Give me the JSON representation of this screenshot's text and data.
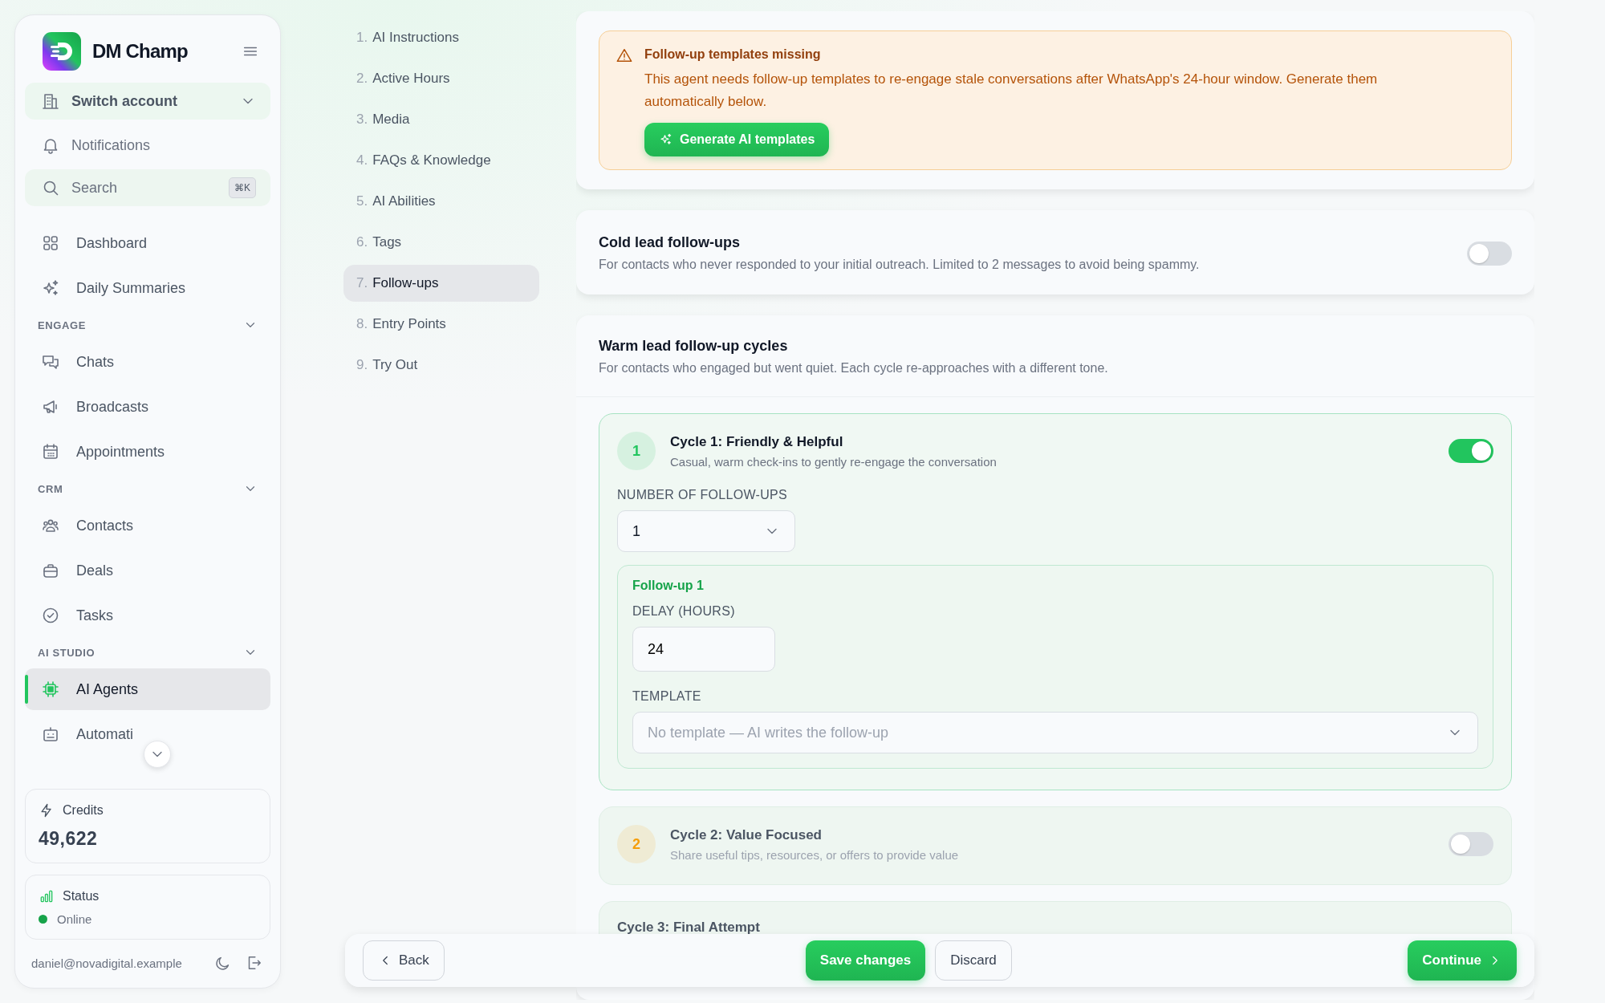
{
  "sidebar": {
    "brand": "DM Champ",
    "switch_account": "Switch account",
    "notifications": "Notifications",
    "search": {
      "placeholder": "Search",
      "shortcut": "⌘K"
    },
    "items": [
      {
        "label": "Dashboard",
        "selected": false
      },
      {
        "label": "Daily Summaries",
        "selected": false
      }
    ],
    "sections": [
      {
        "title": "ENGAGE",
        "items": [
          {
            "label": "Chats",
            "selected": false
          },
          {
            "label": "Broadcasts",
            "selected": false
          },
          {
            "label": "Appointments",
            "selected": false
          }
        ]
      },
      {
        "title": "CRM",
        "items": [
          {
            "label": "Contacts",
            "selected": false
          },
          {
            "label": "Deals",
            "selected": false
          },
          {
            "label": "Tasks",
            "selected": false
          }
        ]
      },
      {
        "title": "AI STUDIO",
        "items": [
          {
            "label": "AI Agents",
            "selected": true
          },
          {
            "label": "Automati",
            "selected": false
          }
        ]
      }
    ],
    "credits": {
      "label": "Credits",
      "value": "49,622"
    },
    "status": {
      "label": "Status",
      "value": "Online",
      "color": "#16a34a"
    },
    "user_email": "daniel@novadigital.example"
  },
  "steps": [
    {
      "number": "1.",
      "label": "AI Instructions",
      "selected": false
    },
    {
      "number": "2.",
      "label": "Active Hours",
      "selected": false
    },
    {
      "number": "3.",
      "label": "Media",
      "selected": false
    },
    {
      "number": "4.",
      "label": "FAQs & Knowledge",
      "selected": false
    },
    {
      "number": "5.",
      "label": "AI Abilities",
      "selected": false
    },
    {
      "number": "6.",
      "label": "Tags",
      "selected": false
    },
    {
      "number": "7.",
      "label": "Follow-ups",
      "selected": true
    },
    {
      "number": "8.",
      "label": "Entry Points",
      "selected": false
    },
    {
      "number": "9.",
      "label": "Try Out",
      "selected": false
    }
  ],
  "alert": {
    "title": "Follow-up templates missing",
    "message": "This agent needs follow-up templates to re-engage stale conversations after WhatsApp's 24-hour window. Generate them automatically below.",
    "button": "Generate AI templates"
  },
  "cold_leads": {
    "title": "Cold lead follow-ups",
    "description": "For contacts who never responded to your initial outreach. Limited to 2 messages to avoid being spammy.",
    "on": false
  },
  "warm_leads": {
    "title": "Warm lead follow-up cycles",
    "description": "For contacts who engaged but went quiet. Each cycle re-approaches with a different tone.",
    "cycles": [
      {
        "number": "1",
        "title": "Cycle 1: Friendly & Helpful",
        "description": "Casual, warm check-ins to gently re-engage the conversation",
        "on": true,
        "color": "#22c55e",
        "count_label": "NUMBER OF FOLLOW-UPS",
        "count": "1",
        "followups": [
          {
            "title": "Follow-up 1",
            "delay_label": "DELAY (HOURS)",
            "delay": "24",
            "template_label": "TEMPLATE",
            "template_placeholder": "No template — AI writes the follow-up"
          }
        ]
      },
      {
        "number": "2",
        "title": "Cycle 2: Value Focused",
        "description": "Share useful tips, resources, or offers to provide value",
        "on": false,
        "color": "#f59e0b"
      },
      {
        "title": "Cycle 3: Final Attempt"
      }
    ]
  },
  "actions": {
    "back": "Back",
    "save": "Save changes",
    "discard": "Discard",
    "continue": "Continue"
  }
}
